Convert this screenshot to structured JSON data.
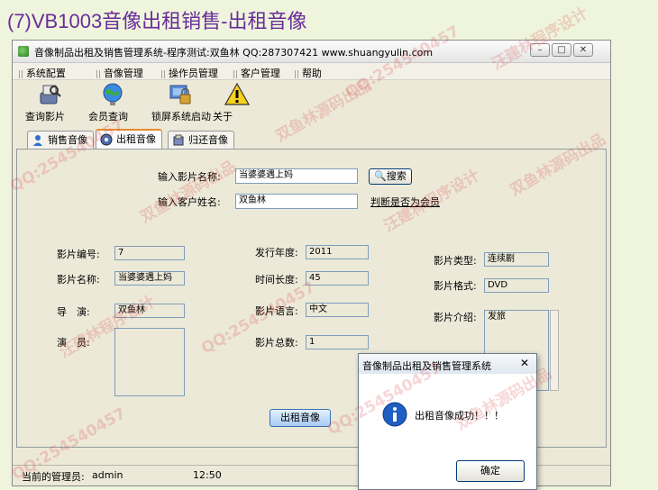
{
  "page_heading": "(7)VB1003音像出租销售-出租音像",
  "window": {
    "title": "音像制品出租及销售管理系统-程序测试:双鱼林 QQ:287307421 www.shuangyulin.com",
    "controls": [
      "minimize-icon",
      "maximize-icon",
      "close-icon"
    ]
  },
  "menu": [
    "系统配置",
    "音像管理",
    "操作员管理",
    "客户管理",
    "帮助"
  ],
  "toolbar": [
    {
      "label": "查询影片",
      "icon": "search-film-icon"
    },
    {
      "label": "会员查询",
      "icon": "globe-member-icon"
    },
    {
      "label": "锁屏系统启动",
      "icon": "lock-screen-icon"
    },
    {
      "label": "关于",
      "icon": "warning-about-icon"
    }
  ],
  "tabs": [
    {
      "label": "销售音像",
      "active": false
    },
    {
      "label": "出租音像",
      "active": true
    },
    {
      "label": "归还音像",
      "active": false
    }
  ],
  "form": {
    "film_name_label": "输入影片名称:",
    "film_name_value": "当婆婆遇上妈",
    "search_button": "搜索",
    "customer_label": "输入客户姓名:",
    "customer_value": "双鱼林",
    "member_check_link": "判断是否为会员",
    "film_no_label": "影片编号:",
    "film_no_value": "7",
    "film_title_label": "影片名称:",
    "film_title_value": "当婆婆遇上妈",
    "director_label": "导　演:",
    "director_value": "双鱼林",
    "actor_label": "演　员:",
    "actor_value": "",
    "year_label": "发行年度:",
    "year_value": "2011",
    "duration_label": "时间长度:",
    "duration_value": "45",
    "language_label": "影片语言:",
    "language_value": "中文",
    "total_label": "影片总数:",
    "total_value": "1",
    "type_label": "影片类型:",
    "type_value": "连续剧",
    "format_label": "影片格式:",
    "format_value": "DVD",
    "intro_label": "影片介绍:",
    "intro_value": "发旅",
    "rent_button": "出租音像"
  },
  "status": {
    "admin_label": "当前的管理员:",
    "admin_value": "admin",
    "time": "12:50"
  },
  "dialog": {
    "title": "音像制品出租及销售管理系统",
    "message": "出租音像成功！！！",
    "ok_button": "确定",
    "close": "✕"
  },
  "watermark": {
    "qq": "QQ:254540457",
    "designer": "汪建林程序设计",
    "source": "双鱼林源码出品"
  },
  "colors": {
    "heading": "#6a2c9a",
    "background": "#eef5dc",
    "window": "#ece9d8",
    "watermark": "#dc4646"
  }
}
